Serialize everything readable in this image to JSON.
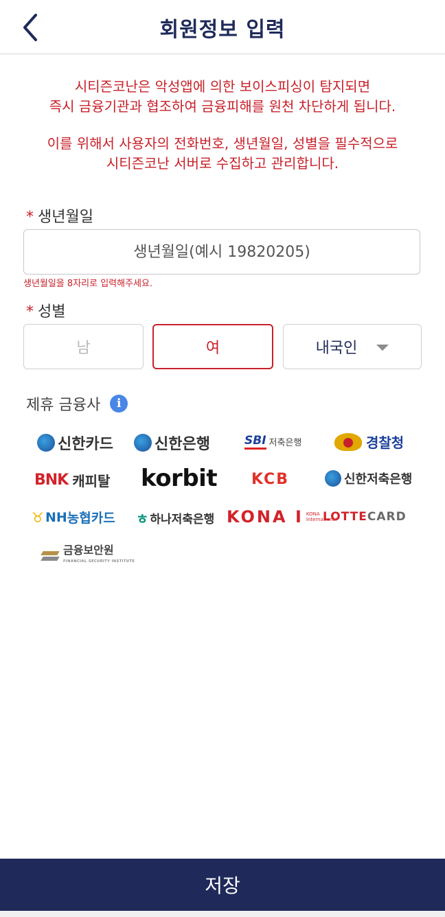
{
  "header": {
    "title": "회원정보 입력",
    "back_icon": "chevron-left-icon"
  },
  "notice": {
    "line1": "시티즌코난은 악성앱에 의한 보이스피싱이 탐지되면",
    "line2": "즉시 금융기관과 협조하여 금융피해를 원천 차단하게 됩니다.",
    "line3": "이를 위해서 사용자의 전화번호, 생년월일, 성별을 필수적으로",
    "line4": "시티즌코난 서버로 수집하고 관리합니다."
  },
  "birth": {
    "required_mark": "*",
    "label": "생년월일",
    "placeholder": "생년월일(예시 19820205)",
    "value": "",
    "hint": "생년월일을 8자리로 입력해주세요."
  },
  "gender": {
    "required_mark": "*",
    "label": "성별",
    "male": "남",
    "female": "여",
    "selected": "여",
    "nationality": "내국인"
  },
  "partners": {
    "label": "제휴 금융사",
    "info_icon": "info-icon",
    "logos": {
      "shinhan_card": "신한카드",
      "shinhan_bank": "신한은행",
      "sbi_mark": "SBI",
      "sbi_text": "저축은행",
      "police": "경찰청",
      "bnk_mark": "BNK",
      "bnk_text": "캐피탈",
      "korbit": "korbit",
      "kcb": "KCB",
      "shinhan_savings": "신한저축은행",
      "nh_mark": "NH",
      "nh_text": "농협카드",
      "hana": "하나저축은행",
      "kona": "KONA I",
      "kona_sub": "KONA International",
      "lotte_mark": "LOTTE",
      "lotte_text": "CARD",
      "fsi": "금융보안원",
      "fsi_sub": "FINANCIAL SECURITY INSTITUTE"
    }
  },
  "save_label": "저장",
  "colors": {
    "navy": "#1f2a5a",
    "red": "#c8202a",
    "info_blue": "#4a86e8"
  }
}
